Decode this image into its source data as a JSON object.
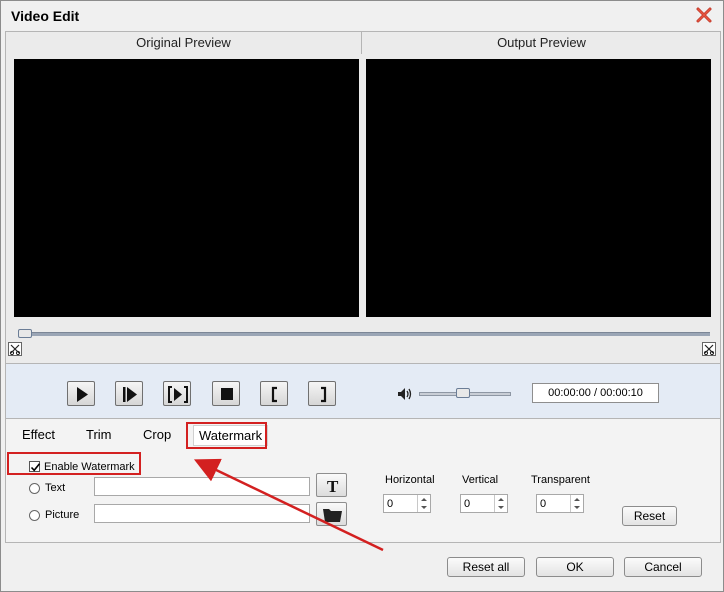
{
  "window": {
    "title": "Video Edit"
  },
  "preview": {
    "original_label": "Original Preview",
    "output_label": "Output Preview"
  },
  "playback": {
    "time": "00:00:00 / 00:00:10"
  },
  "tabs": [
    {
      "label": "Effect"
    },
    {
      "label": "Trim"
    },
    {
      "label": "Crop"
    },
    {
      "label": "Watermark"
    }
  ],
  "watermark": {
    "enable_label": "Enable Watermark",
    "enabled": true,
    "text_option": "Text",
    "picture_option": "Picture",
    "text_value": "",
    "picture_value": "",
    "horizontal_label": "Horizontal",
    "vertical_label": "Vertical",
    "transparent_label": "Transparent",
    "horizontal_value": "0",
    "vertical_value": "0",
    "transparent_value": "0",
    "reset_label": "Reset"
  },
  "footer": {
    "reset_all_label": "Reset all",
    "ok_label": "OK",
    "cancel_label": "Cancel"
  },
  "colors": {
    "annotation": "#d32020",
    "controls_bg": "#e4ebf5"
  }
}
